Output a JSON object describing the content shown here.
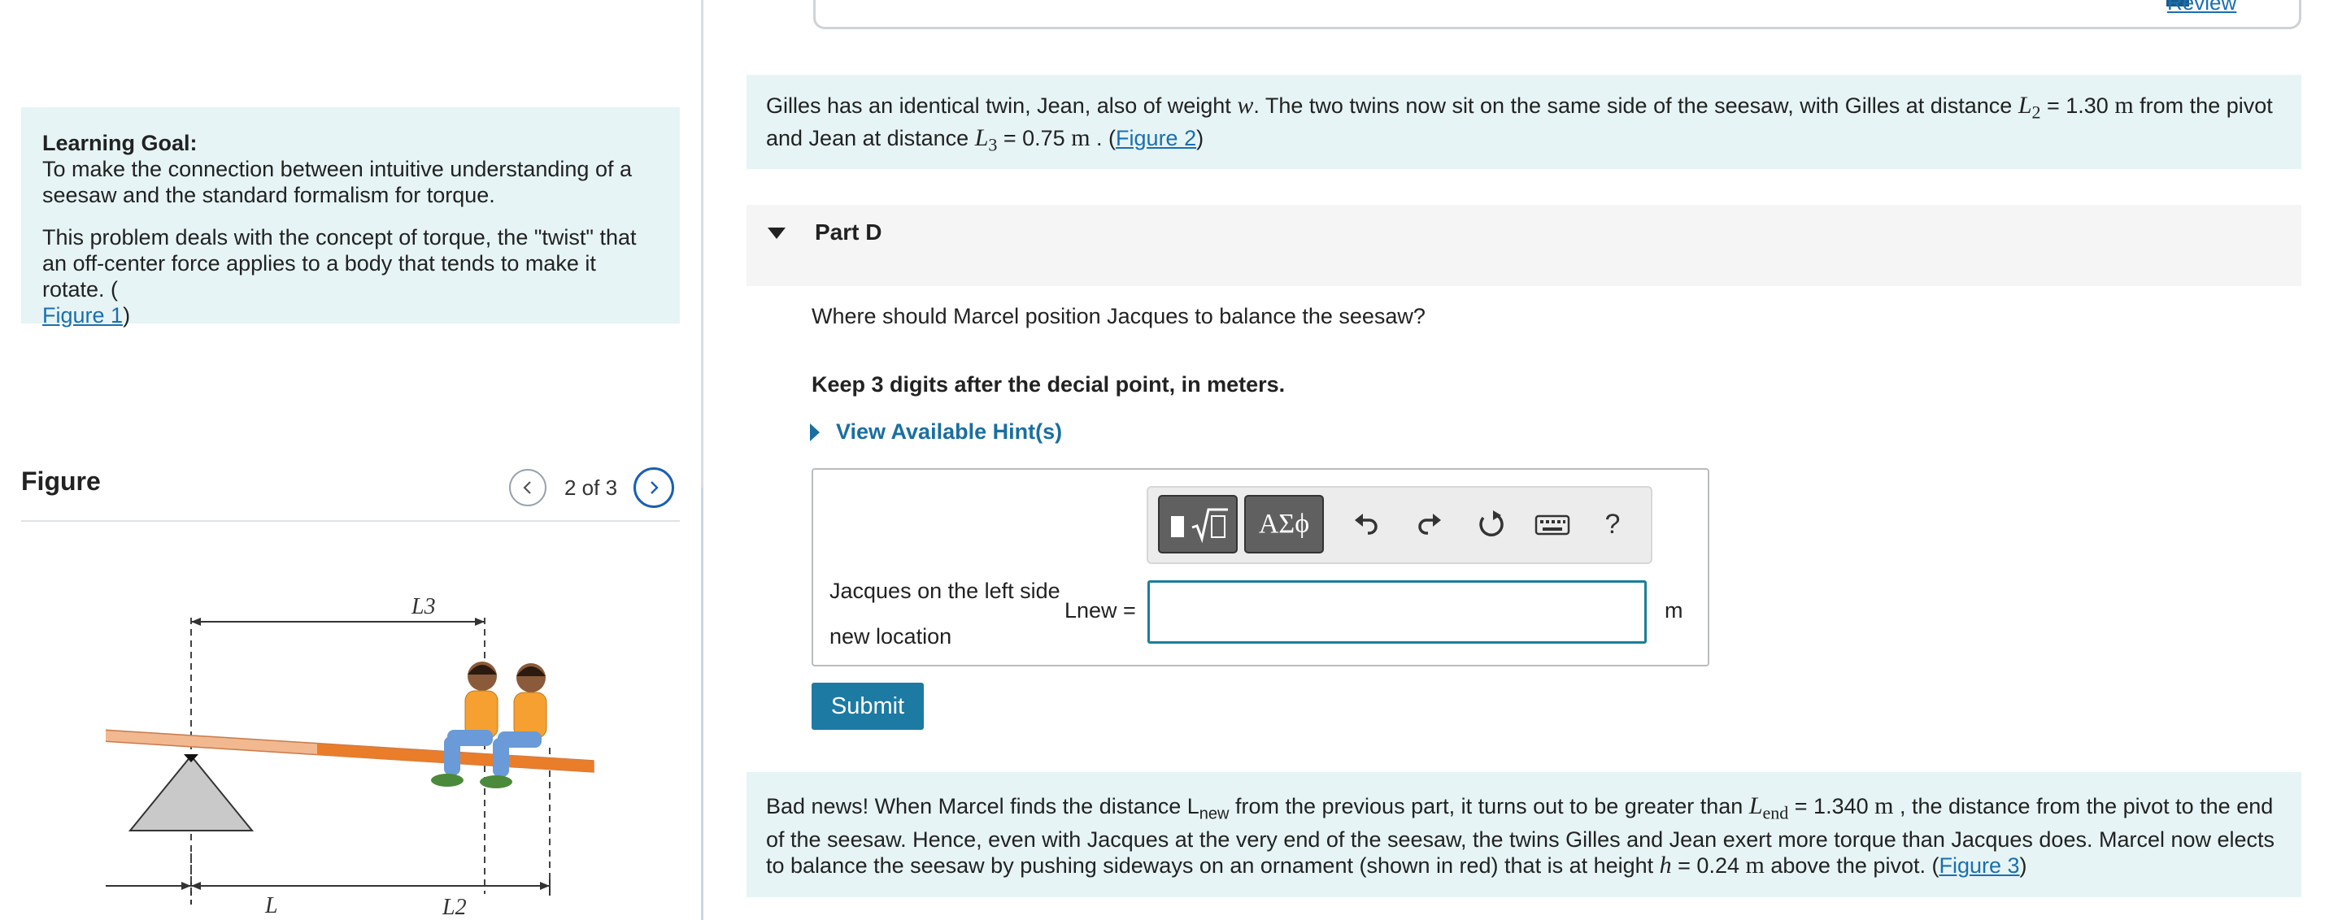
{
  "header": {
    "review_label": "Review"
  },
  "learning_goal": {
    "title": "Learning Goal:",
    "text": "To make the connection between intuitive understanding of a seesaw and the standard formalism for torque.",
    "desc": "This problem deals with the concept of torque, the \"twist\" that an off-center force applies to a body that tends to make it rotate. (",
    "figure_link": "Figure 1",
    "desc_end": ")"
  },
  "figure": {
    "title": "Figure",
    "counter": "2 of 3",
    "labels": {
      "l3": "L3",
      "l": "L",
      "l2": "L2"
    }
  },
  "info1": {
    "t1": "Gilles has an identical twin, Jean, also of weight ",
    "w": "w",
    "t2": ". The two twins now sit on the same side of the seesaw, with Gilles at distance ",
    "L2": "L",
    "L2sub": "2",
    "eq1": " = 1.30 ",
    "m1": "m",
    "t3": " from the pivot and Jean at distance ",
    "L3": "L",
    "L3sub": "3",
    "eq2": " = 0.75 ",
    "m2": "m",
    "t4": " . (",
    "link": "Figure 2",
    "t5": ")"
  },
  "part": {
    "title": "Part D"
  },
  "question": "Where should Marcel position Jacques to balance the seesaw?",
  "instruction": "Keep 3 digits after the decial point, in meters.",
  "hint": "View Available Hint(s)",
  "toolbar": {
    "greek": "ΑΣϕ",
    "help": "?"
  },
  "answer": {
    "side_label_1": "Jacques on the left side",
    "side_label_2": "new location",
    "lnew_label": "Lnew =",
    "value": "",
    "unit": "m"
  },
  "submit_label": "Submit",
  "info2": {
    "t1": "Bad news! When Marcel finds the distance L",
    "sub1": "new",
    "t2": " from the previous part, it turns out to be greater than ",
    "Lend": "L",
    "Lendsub": "end",
    "eq1": " = 1.340 ",
    "m1": "m",
    "t3": " , the distance from the pivot to the end of the seesaw. Hence, even with Jacques at the very end of the seesaw, the twins Gilles and Jean exert more torque than Jacques does. Marcel now elects to balance the seesaw by pushing sideways on an ornament (shown in red) that is at height ",
    "h": "h",
    "eq2": " = 0.24 ",
    "m2": "m",
    "t4": " above the pivot. (",
    "link": "Figure 3",
    "t5": ")"
  },
  "colors": {
    "accent": "#1d7aa2",
    "info_bg": "#e6f4f5",
    "link": "#1a6fb0"
  }
}
